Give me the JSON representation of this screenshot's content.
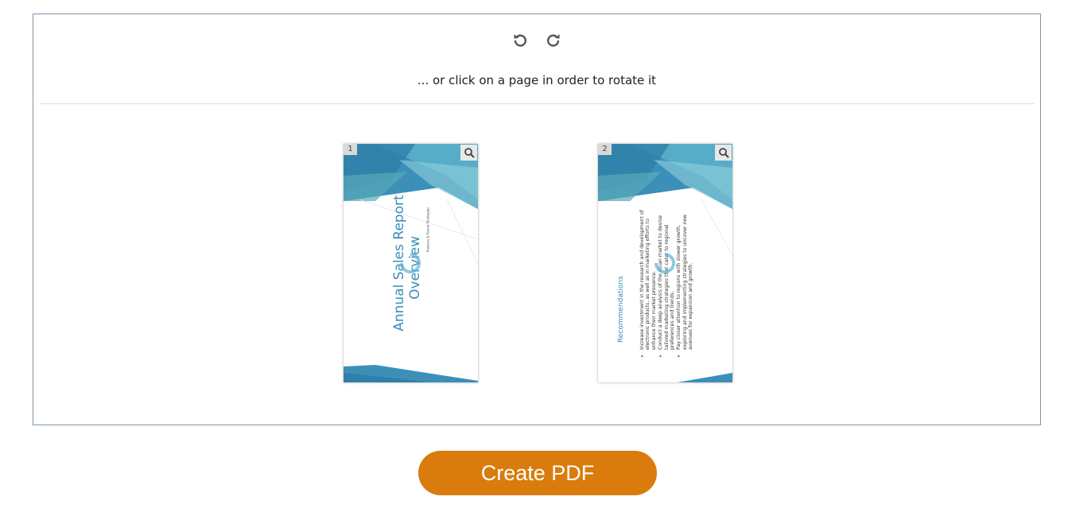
{
  "toolbar": {
    "rotate_left_icon": "rotate-ccw-icon",
    "rotate_right_icon": "rotate-cw-icon"
  },
  "hint_text": "... or click on a page in order to rotate it",
  "pages": [
    {
      "number": "1",
      "title_line1": "Annual Sales Report",
      "title_line2": "Overview",
      "subtitle": "Analysis & Future Strategies"
    },
    {
      "number": "2",
      "heading": "Recommendations",
      "bullets": [
        "Increase investment in the research and development of electronic products, as well as in marketing efforts to enhance their market presence.",
        "Conduct a deep analysis of the Asian market to devise tailored marketing strategies that cater to regional preferences and trends.",
        "Pay closer attention to regions with slower growth, exploring and implementing strategies to uncover new avenues for expansion and growth."
      ]
    }
  ],
  "create_button": {
    "label": "Create PDF"
  },
  "colors": {
    "accent_orange": "#d97c0d",
    "slide_blue": "#3a8fb7",
    "panel_border": "#7d95a8"
  }
}
